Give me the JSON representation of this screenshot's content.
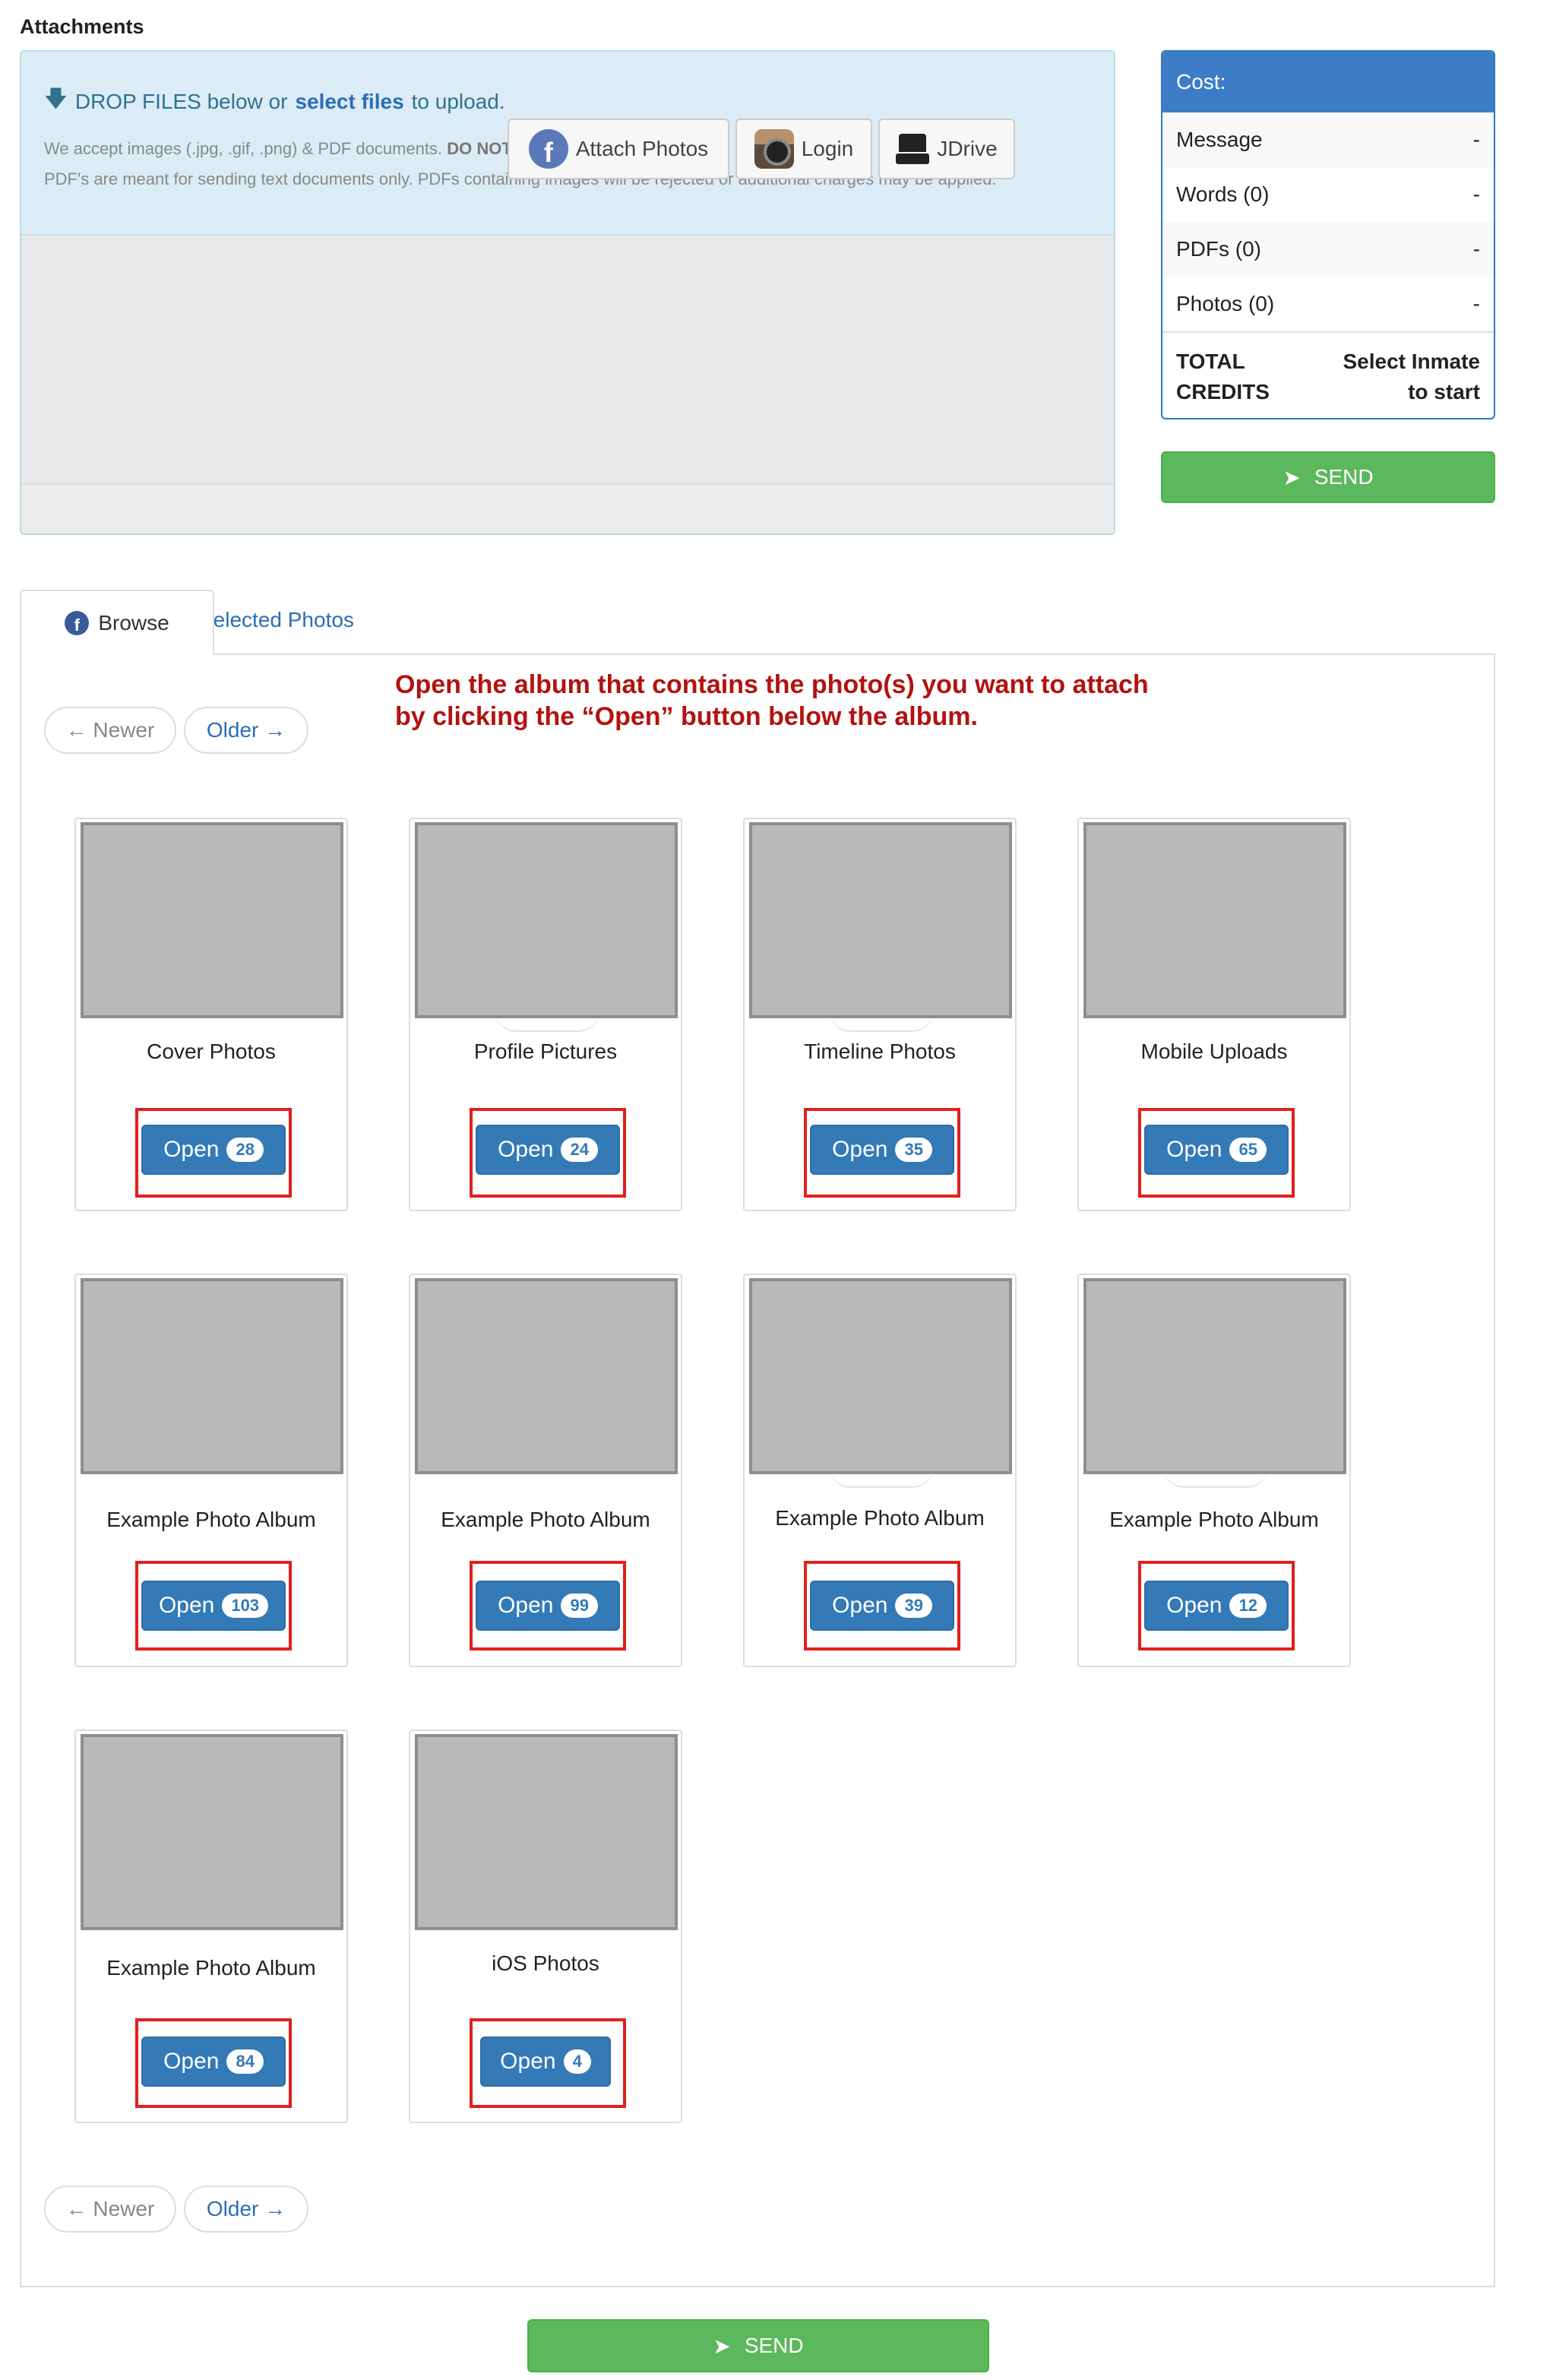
{
  "attachments": {
    "title": "Attachments",
    "drop_prefix": "DROP FILES below or",
    "select_files": "select files",
    "drop_suffix": "to upload.",
    "note_line1_a": "We accept images (.jpg, .gif, .png) & PDF documents.",
    "note_line1_b": "DO NOT SEND IMAGES IN PDFs.",
    "note_line2": "PDF's are meant for sending text documents only. PDFs containing images will be rejected or additional charges may be applied.",
    "buttons": {
      "attach_photos": "Attach Photos",
      "login": "Login",
      "jdrive": "JDrive"
    }
  },
  "cost": {
    "header": "Cost:",
    "rows": [
      {
        "label": "Message",
        "value": "-"
      },
      {
        "label": "Words (0)",
        "value": "-"
      },
      {
        "label": "PDFs (0)",
        "value": "-"
      },
      {
        "label": "Photos (0)",
        "value": "-"
      }
    ],
    "total_label_1": "TOTAL",
    "total_label_2": "CREDITS",
    "total_value_1": "Select Inmate",
    "total_value_2": "to start"
  },
  "send_label": "SEND",
  "tabs": {
    "browse": "Browse",
    "selected": "Selected Photos"
  },
  "instruction": {
    "line1": "Open the album that contains the photo(s) you want to attach",
    "line2": "by clicking the “Open” button below the album."
  },
  "pager": {
    "newer": "← Newer",
    "older": "Older →"
  },
  "albums": [
    {
      "title": "Cover Photos",
      "open_label": "Open",
      "count": "28"
    },
    {
      "title": "Profile Pictures",
      "open_label": "Open",
      "count": "24"
    },
    {
      "title": "Timeline Photos",
      "open_label": "Open",
      "count": "35"
    },
    {
      "title": "Mobile Uploads",
      "open_label": "Open",
      "count": "65"
    },
    {
      "title": "Example Photo Album",
      "open_label": "Open",
      "count": "103"
    },
    {
      "title": "Example Photo Album",
      "open_label": "Open",
      "count": "99"
    },
    {
      "title": "Example Photo Album",
      "open_label": "Open",
      "count": "39"
    },
    {
      "title": "Example Photo Album",
      "open_label": "Open",
      "count": "12"
    },
    {
      "title": "Example Photo Album",
      "open_label": "Open",
      "count": "84"
    },
    {
      "title": "iOS Photos",
      "open_label": "Open",
      "count": "4"
    }
  ],
  "colors": {
    "primary": "#337ab7",
    "success": "#5cb85c",
    "instruction_red": "#b3120f",
    "highlight_red": "#e0201d",
    "dropzone_bg": "#dbecf6"
  }
}
